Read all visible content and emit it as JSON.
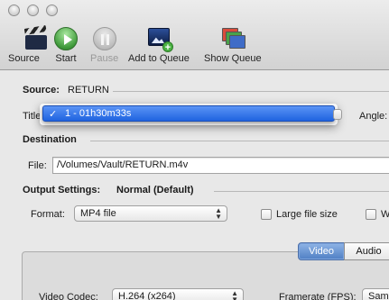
{
  "toolbar": {
    "items": [
      {
        "label": "Source",
        "icon": "clapperboard-icon"
      },
      {
        "label": "Start",
        "icon": "play-icon"
      },
      {
        "label": "Pause",
        "icon": "pause-icon"
      },
      {
        "label": "Add to Queue",
        "icon": "add-to-queue-icon"
      },
      {
        "label": "Show Queue",
        "icon": "show-queue-icon"
      }
    ]
  },
  "source": {
    "label": "Source:",
    "value": "RETURN"
  },
  "title": {
    "label": "Title",
    "selected": "1 - 01h30m33s",
    "check": "✓"
  },
  "angle": {
    "label": "Angle:"
  },
  "destination": {
    "heading": "Destination",
    "file_label": "File:",
    "file_value": "/Volumes/Vault/RETURN.m4v"
  },
  "output": {
    "label": "Output Settings:",
    "preset": "Normal (Default)",
    "format_label": "Format:",
    "format_value": "MP4 file",
    "large_file_label": "Large file size",
    "web_initial": "W"
  },
  "tabs": {
    "video": "Video",
    "audio": "Audio"
  },
  "video": {
    "codec_label": "Video Codec:",
    "codec_value": "H.264 (x264)",
    "framerate_label": "Framerate (FPS):",
    "framerate_value": "Sam"
  },
  "colors": {
    "accent": "#2a6be6",
    "start_green": "#3f9a3a"
  }
}
